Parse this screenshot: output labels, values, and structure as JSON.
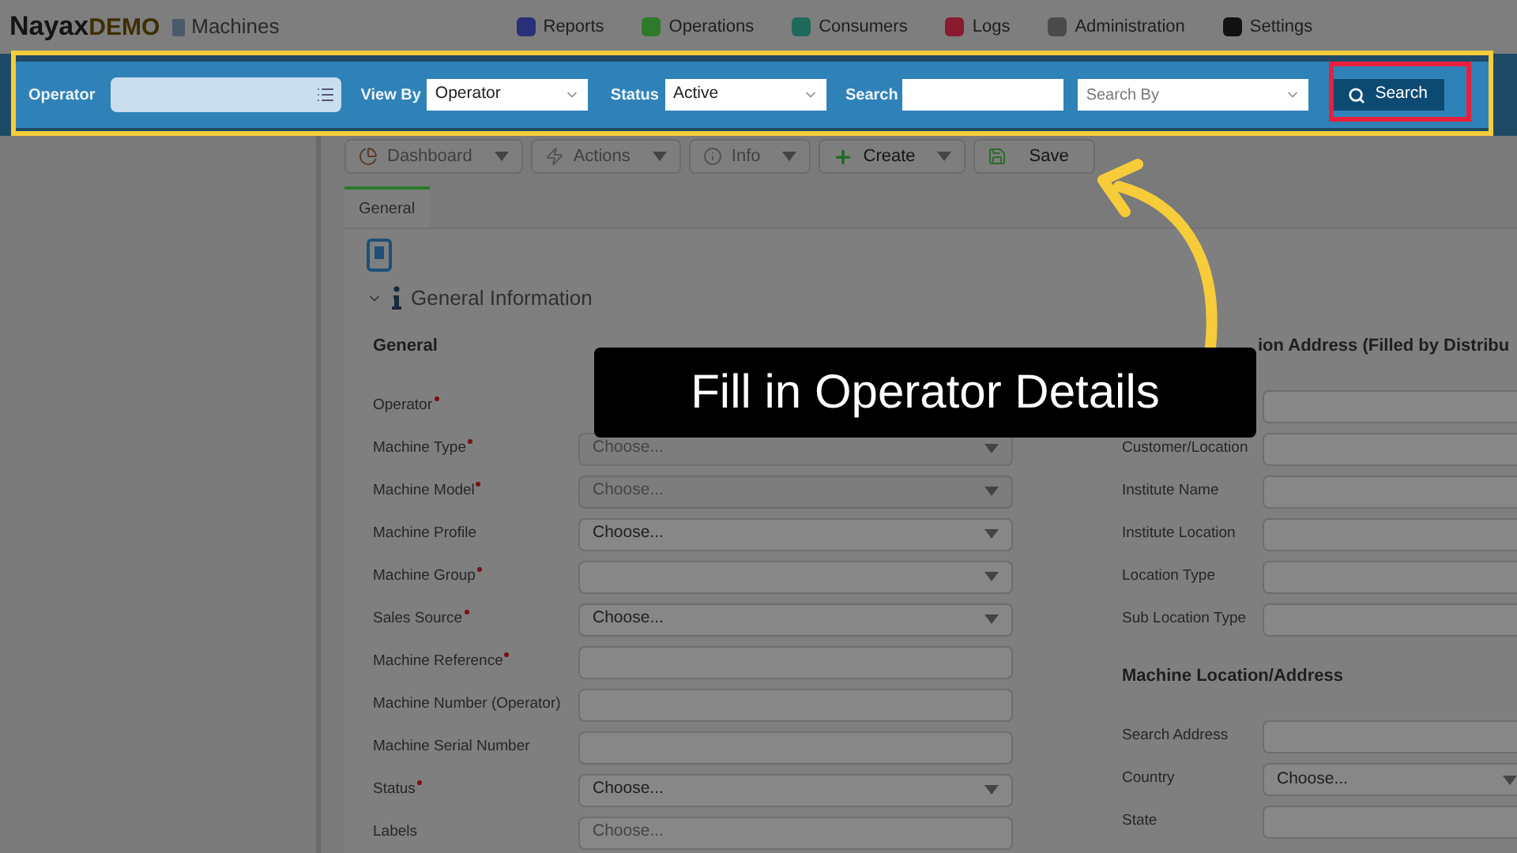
{
  "header": {
    "brand": "Nayax",
    "brand_suffix": "DEMO",
    "page_title": "Machines",
    "nav": [
      {
        "label": "Reports",
        "color": "#2a2f7a"
      },
      {
        "label": "Operations",
        "color": "#2f7a2a"
      },
      {
        "label": "Consumers",
        "color": "#1f6a5a"
      },
      {
        "label": "Logs",
        "color": "#8a1a30"
      },
      {
        "label": "Administration",
        "color": "#4a4a4a"
      },
      {
        "label": "Settings",
        "color": "#111111"
      }
    ]
  },
  "filter_bar": {
    "operator_label": "Operator",
    "view_by_label": "View By",
    "view_by_value": "Operator",
    "status_label": "Status",
    "status_value": "Active",
    "search_label": "Search",
    "search_by_placeholder": "Search By",
    "search_button": "Search"
  },
  "toolbar": [
    {
      "label": "Dashboard",
      "kind": "dashboard",
      "dropdown": true,
      "disabled": true
    },
    {
      "label": "Actions",
      "kind": "actions",
      "dropdown": true,
      "disabled": true
    },
    {
      "label": "Info",
      "kind": "info",
      "dropdown": true,
      "disabled": true
    },
    {
      "label": "Create",
      "kind": "create",
      "dropdown": true,
      "disabled": false
    },
    {
      "label": "Save",
      "kind": "save",
      "dropdown": false,
      "disabled": false
    }
  ],
  "tabs": [
    {
      "label": "General",
      "selected": true
    }
  ],
  "section_title": "General Information",
  "left": {
    "heading": "General",
    "fields": [
      {
        "label": "Operator",
        "required": true
      },
      {
        "label": "Machine Type",
        "required": true,
        "kind": "select",
        "placeholder": "Choose...",
        "disabled": true
      },
      {
        "label": "Machine Model",
        "required": true,
        "kind": "select",
        "placeholder": "Choose...",
        "disabled": true
      },
      {
        "label": "Machine Profile",
        "required": false,
        "kind": "select",
        "value": "Choose...",
        "disabled": false
      },
      {
        "label": "Machine Group",
        "required": true,
        "kind": "select",
        "disabled": false
      },
      {
        "label": "Sales Source",
        "required": true,
        "kind": "select",
        "value": "Choose...",
        "disabled": false
      },
      {
        "label": "Machine Reference",
        "required": true,
        "kind": "text"
      },
      {
        "label": "Machine Number (Operator)",
        "required": false,
        "kind": "text"
      },
      {
        "label": "Machine Serial Number",
        "required": false,
        "kind": "text"
      },
      {
        "label": "Status",
        "required": true,
        "kind": "select",
        "value": "Choose...",
        "disabled": false
      },
      {
        "label": "Labels",
        "required": false,
        "kind": "text",
        "placeholder": "Choose..."
      }
    ]
  },
  "right": {
    "heading": "ion Address (Filled by Distribu",
    "fields": [
      {
        "kind": "text"
      },
      {
        "label": "Customer/Location",
        "kind": "text"
      },
      {
        "label": "Institute Name",
        "kind": "text"
      },
      {
        "label": "Institute Location",
        "kind": "text"
      },
      {
        "label": "Location Type",
        "kind": "text"
      },
      {
        "label": "Sub Location Type",
        "kind": "text"
      }
    ],
    "heading2": "Machine Location/Address",
    "fields2": [
      {
        "label": "Search Address",
        "kind": "text"
      },
      {
        "label": "Country",
        "kind": "select",
        "value": "Choose..."
      },
      {
        "label": "State",
        "kind": "text"
      }
    ]
  },
  "callout": "Fill in Operator Details"
}
